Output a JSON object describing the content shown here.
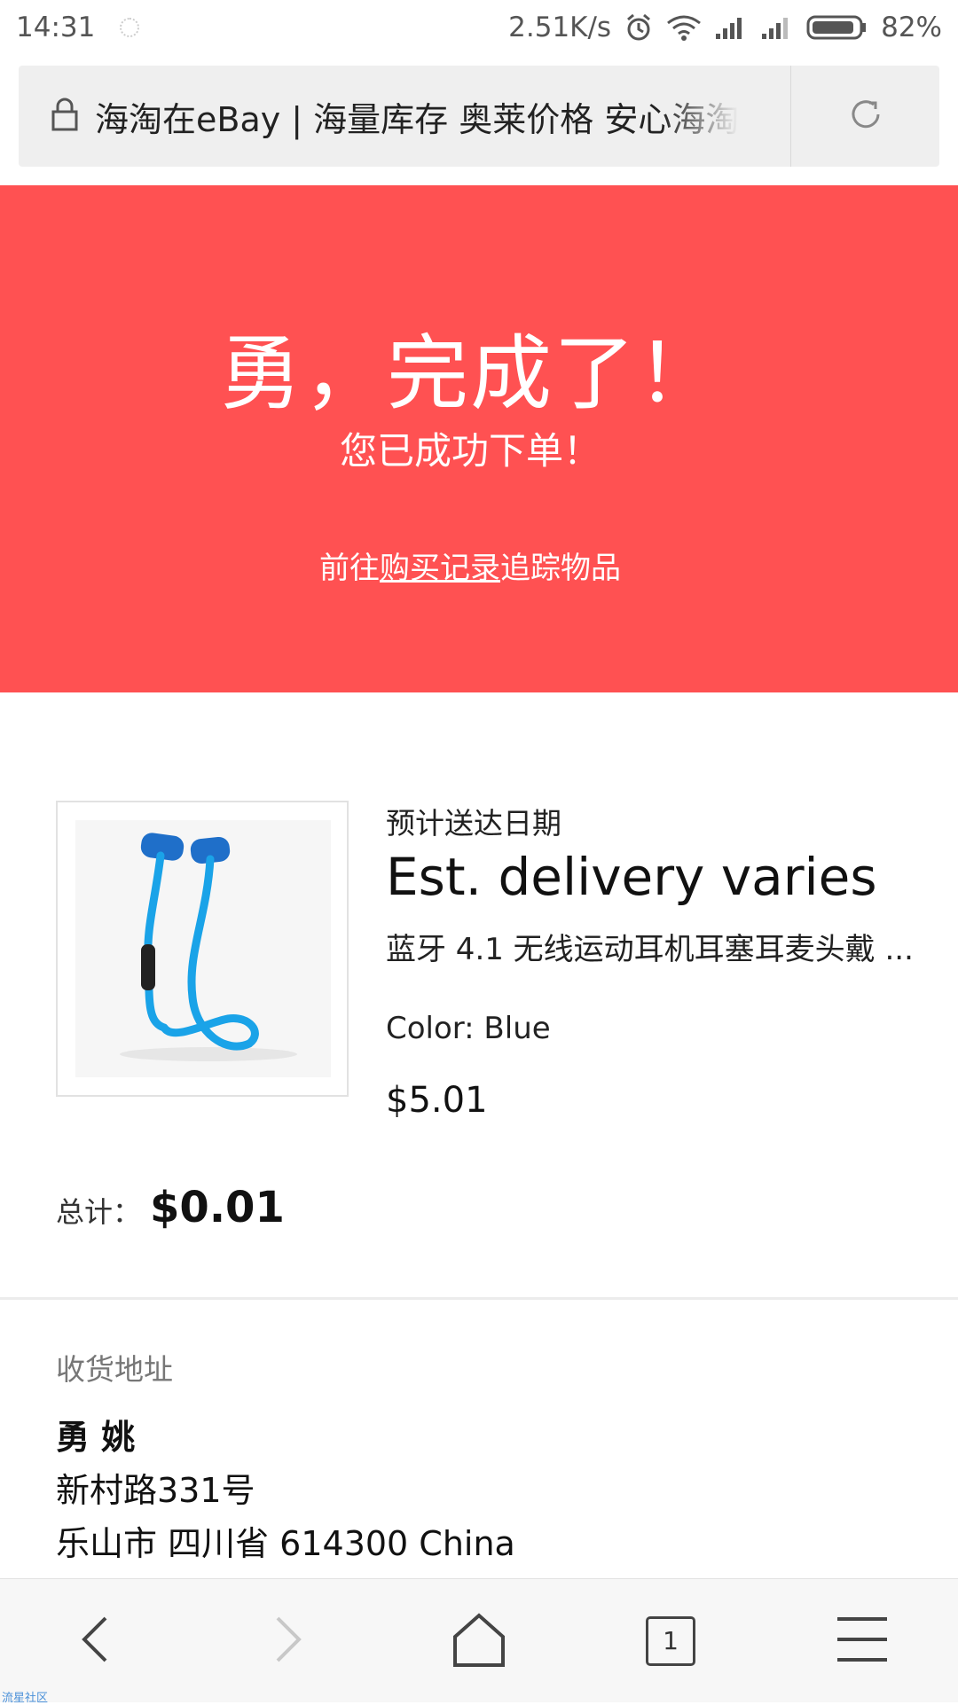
{
  "status_bar": {
    "time": "14:31",
    "net_speed": "2.51K/s",
    "battery": "82%",
    "icons": [
      "loading-icon",
      "alarm-icon",
      "wifi-icon",
      "signal-icon",
      "signal-icon",
      "battery-icon"
    ]
  },
  "url_bar": {
    "title": "海淘在eBay | 海量库存 奥莱价格 安心海淘",
    "icons": [
      "lock-icon",
      "reload-icon"
    ]
  },
  "hero": {
    "title": "勇，完成了！",
    "subtitle": "您已成功下单！",
    "link_prefix": "前往",
    "link_text": "购买记录",
    "link_suffix": "追踪物品",
    "background": "#ff5152"
  },
  "order": {
    "est_label": "预计送达日期",
    "est_value": "Est. delivery varies",
    "product_title": "蓝牙 4.1 无线运动耳机耳塞耳麦头戴 ...",
    "color": "Color: Blue",
    "price": "$5.01",
    "image_icon": "earphones-icon",
    "image_color": "#1aa3e8"
  },
  "total": {
    "label": "总计：",
    "value": "$0.01"
  },
  "shipping": {
    "label": "收货地址",
    "name": "勇 姚",
    "line1": "新村路331号",
    "line2": "乐山市 四川省 614300 China"
  },
  "bottom_nav": {
    "tab_count": "1",
    "icons": [
      "back-icon",
      "forward-icon",
      "home-icon",
      "tabs-icon",
      "menu-icon"
    ]
  },
  "watermark": "流星社区"
}
